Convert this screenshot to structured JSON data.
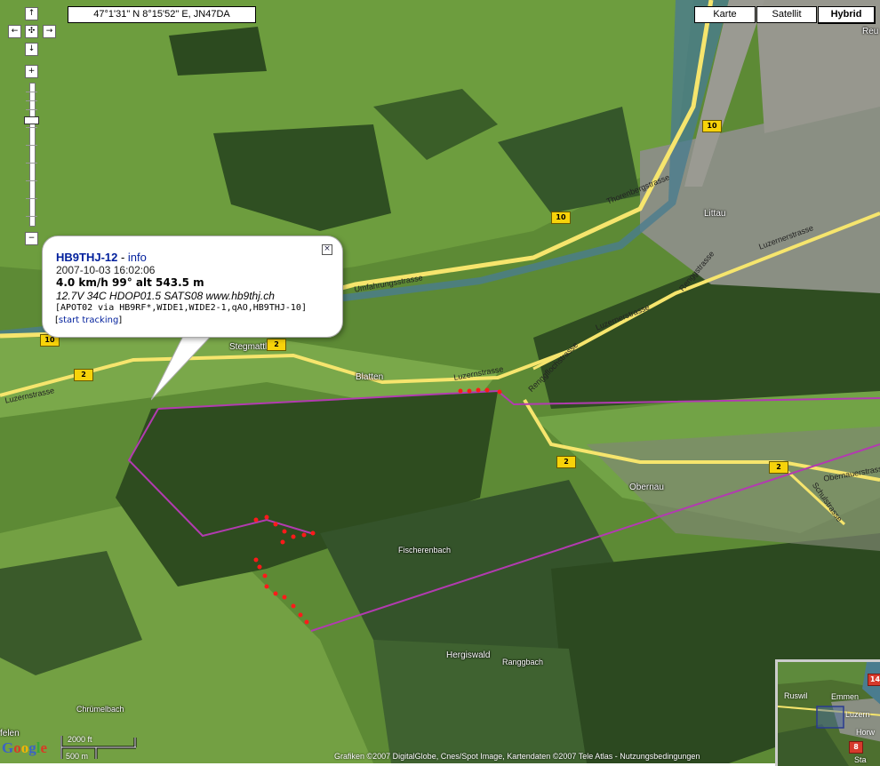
{
  "coords": "47°1'31\" N 8°15'52\" E, JN47DA",
  "maptypes": {
    "karte": "Karte",
    "satellit": "Satellit",
    "hybrid": "Hybrid"
  },
  "controls": {
    "up": "↑",
    "left": "←",
    "center": "✣",
    "right": "→",
    "down": "↓",
    "zoom_in": "+",
    "zoom_out": "−"
  },
  "popup": {
    "callsign": "HB9THJ-12",
    "separator": " - ",
    "info_link": "info",
    "timestamp": "2007-10-03 16:02:06",
    "motion": "4.0 km/h 99° alt 543.5 m",
    "telemetry": "12.7V 34C HDOP01.5 SATS08 www.hb9thj.ch",
    "path": "[APOT02 via HB9RF*,WIDE1,WIDE2-1,qAO,HB9THJ-10]",
    "track_open": "[",
    "track_link": "start tracking",
    "track_close": "]",
    "close": "×"
  },
  "places": {
    "littau": "Littau",
    "blatten": "Blatten",
    "obernau": "Obernau",
    "hergiswald": "Hergiswald",
    "ranggbach": "Ranggbach",
    "fischerenbach": "Fischerenbach",
    "chrumelbach": "Chrümelbach",
    "stegmattli": "Stegmattli",
    "reu": "Reu",
    "feleri": "felen"
  },
  "roads": {
    "luzernstrasse_w": "Luzernstrasse",
    "umfahrungsstrasse": "Umfahrungsstrasse",
    "thorenbergstrasse": "Thorenbergstrasse",
    "luzernerstrasse_ne": "Luzernerstrasse",
    "renggstrasse": "Renggstrasse",
    "luzernerstrasse_mid": "Luzernerstrasse",
    "luzernstrasse_blatten": "Luzernstrasse",
    "renggflochstrasse": "Renggflochstrasse",
    "obernauerstrasse": "Obernauerstrass",
    "schulstrasse": "Schulstrasse"
  },
  "shields": {
    "r10a": "10",
    "r10b": "10",
    "r10c": "10",
    "r2a": "2",
    "r2b": "2",
    "r2c": "2",
    "r2d": "2"
  },
  "overview": {
    "ruswil": "Ruswil",
    "emmen": "Emmen",
    "luzern": "Luzern",
    "horw": "Horw",
    "sta": "Sta",
    "shield14": "14",
    "shield8": "8"
  },
  "scale": {
    "ft": "2000 ft",
    "m": "500 m"
  },
  "google": {
    "g1": "G",
    "o1": "o",
    "o2": "o",
    "g2": "g",
    "l": "l",
    "e": "e"
  },
  "copyright": "Grafiken ©2007 DigitalGlobe, Cnes/Spot Image, Kartendaten ©2007 Tele Atlas - Nutzungsbedingungen",
  "colors": {
    "track": "#b23bb0",
    "points": "#ff1a1a",
    "road": "#f6e56d"
  }
}
